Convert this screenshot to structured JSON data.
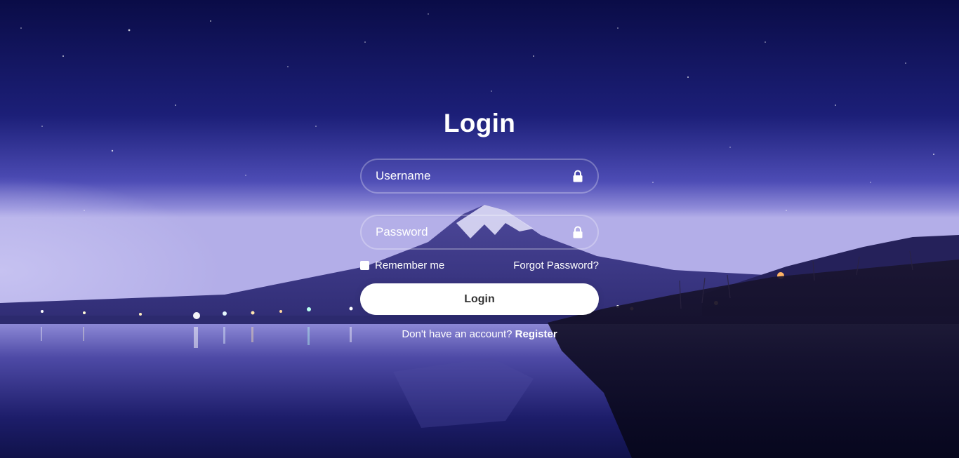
{
  "login_form": {
    "title": "Login",
    "username_placeholder": "Username",
    "password_placeholder": "Password",
    "field_icon": "lock-icon",
    "remember_label": "Remember me",
    "forgot_label": "Forgot Password?",
    "submit_label": "Login",
    "register_prompt": "Don't have an account?",
    "register_label": "Register"
  },
  "background": {
    "description_icon": "mountain-lake-night-scene",
    "sky_top_color": "#0b0d4a",
    "sky_horizon_color": "#8f8be0",
    "water_color": "#2a2a7a"
  }
}
